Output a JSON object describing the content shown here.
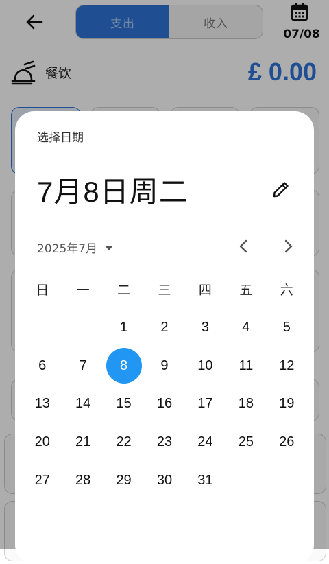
{
  "app": {
    "tabs": {
      "expense": "支出",
      "income": "收入"
    },
    "date_short": "07/08",
    "category": {
      "name": "餐饮",
      "icon": "food-tray-icon"
    },
    "amount": "£ 0.00",
    "colors": {
      "accent": "#2f73d8",
      "selected_day": "#2196f3"
    }
  },
  "picker": {
    "title": "选择日期",
    "headline": "7月8日周二",
    "month_label": "2025年7月",
    "weekdays": [
      "日",
      "一",
      "二",
      "三",
      "四",
      "五",
      "六"
    ],
    "leading_blank_days": 2,
    "days_in_month": 31,
    "selected_day": 8
  }
}
